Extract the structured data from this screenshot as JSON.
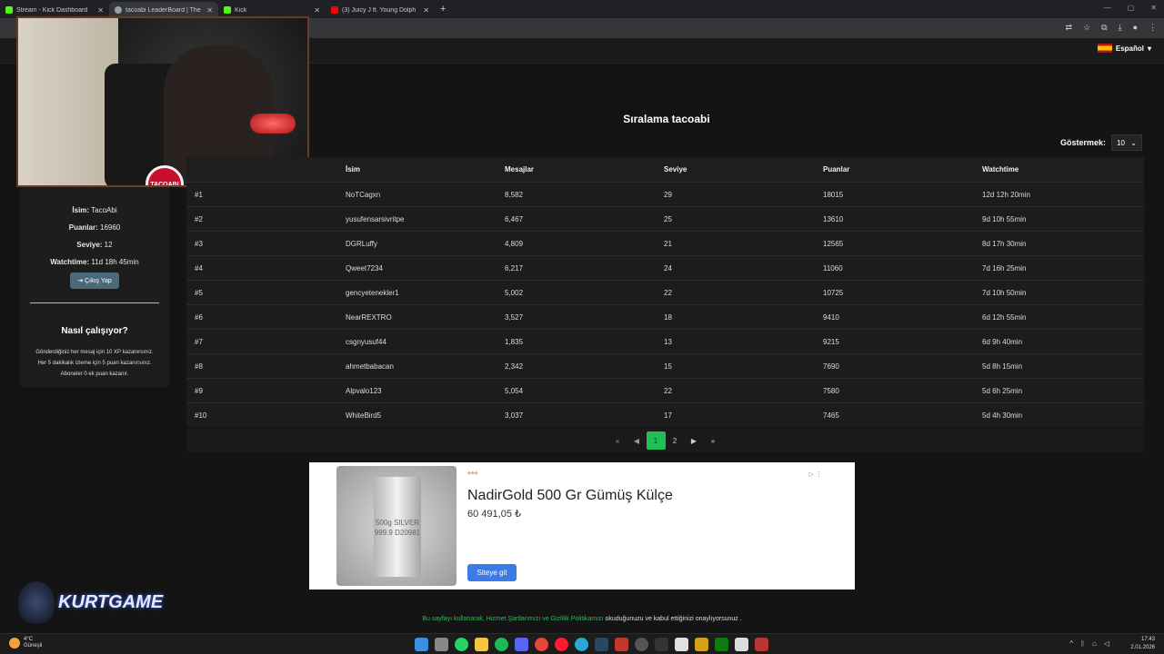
{
  "browser": {
    "tabs": [
      {
        "title": "Stream - Kick Dashboard",
        "color": "#53fc18"
      },
      {
        "title": "tacoabi LeaderBoard | The best",
        "color": "#9aa0a6"
      },
      {
        "title": "Kick",
        "color": "#53fc18"
      },
      {
        "title": "(3) Juicy J ft. Young Dolph",
        "color": "#ff0000"
      }
    ]
  },
  "header": {
    "language": "Español"
  },
  "stream": {
    "badge": "TACOABI"
  },
  "profile": {
    "name_label": "İsim:",
    "name": "TacoAbi",
    "points_label": "Puanlar:",
    "points": "16960",
    "level_label": "Seviye:",
    "level": "12",
    "watchtime_label": "Watchtime:",
    "watchtime": "11d 18h 45min",
    "logout": "Çıkış Yap",
    "how_title": "Nasıl çalışıyor?",
    "how_line1": "Gönderdiğiniz her mesaj için 10 XP kazanırsınız.",
    "how_line2": "Her 5 dakikalık izleme için 5 puan kazanırsınız.",
    "how_line3": "Aboneler 0 ek puan kazanır."
  },
  "leaderboard": {
    "title": "Sıralama tacoabi",
    "show_label": "Göstermek:",
    "show_value": "10",
    "columns": [
      "",
      "İsim",
      "Mesajlar",
      "Seviye",
      "Puanlar",
      "Watchtime"
    ],
    "rows": [
      [
        "#1",
        "NoTCagxn",
        "8,582",
        "29",
        "18015",
        "12d 12h 20min"
      ],
      [
        "#2",
        "yusufensarsivritpe",
        "6,467",
        "25",
        "13610",
        "9d 10h 55min"
      ],
      [
        "#3",
        "DGRLuffy",
        "4,809",
        "21",
        "12565",
        "8d 17h 30min"
      ],
      [
        "#4",
        "Qweet7234",
        "6,217",
        "24",
        "11060",
        "7d 16h 25min"
      ],
      [
        "#5",
        "gencyetenekler1",
        "5,002",
        "22",
        "10725",
        "7d 10h 50min"
      ],
      [
        "#6",
        "NearREXTRO",
        "3,527",
        "18",
        "9410",
        "6d 12h 55min"
      ],
      [
        "#7",
        "csgnyusuf44",
        "1,835",
        "13",
        "9215",
        "6d 9h 40min"
      ],
      [
        "#8",
        "ahmetbabacan",
        "2,342",
        "15",
        "7690",
        "5d 8h 15min"
      ],
      [
        "#9",
        "Alpvalo123",
        "5,054",
        "22",
        "7580",
        "5d 6h 25min"
      ],
      [
        "#10",
        "WhiteBird5",
        "3,037",
        "17",
        "7465",
        "5d 4h 30min"
      ]
    ],
    "pagination": {
      "pages": [
        "1",
        "2"
      ],
      "current": "1"
    }
  },
  "ad": {
    "title": "NadirGold 500 Gr Gümüş Külçe",
    "price": "60 491,05 ₺",
    "button": "Siteye git",
    "bar_text": "500g SILVER 999.9 D20981"
  },
  "footer": {
    "prefix": "Bu sayfayı kullanarak, ",
    "link": "Hizmet Şartlarımızı ve Gizlilik Politikamızı",
    "suffix": " okuduğunuzu ve kabul ettiğinizi onaylıyorsunuz ."
  },
  "overlay": {
    "brand": "KURTGAME"
  },
  "taskbar": {
    "temp": "4°C",
    "weather": "Güneşli",
    "time": "17:43",
    "date": "2.01.2026"
  }
}
